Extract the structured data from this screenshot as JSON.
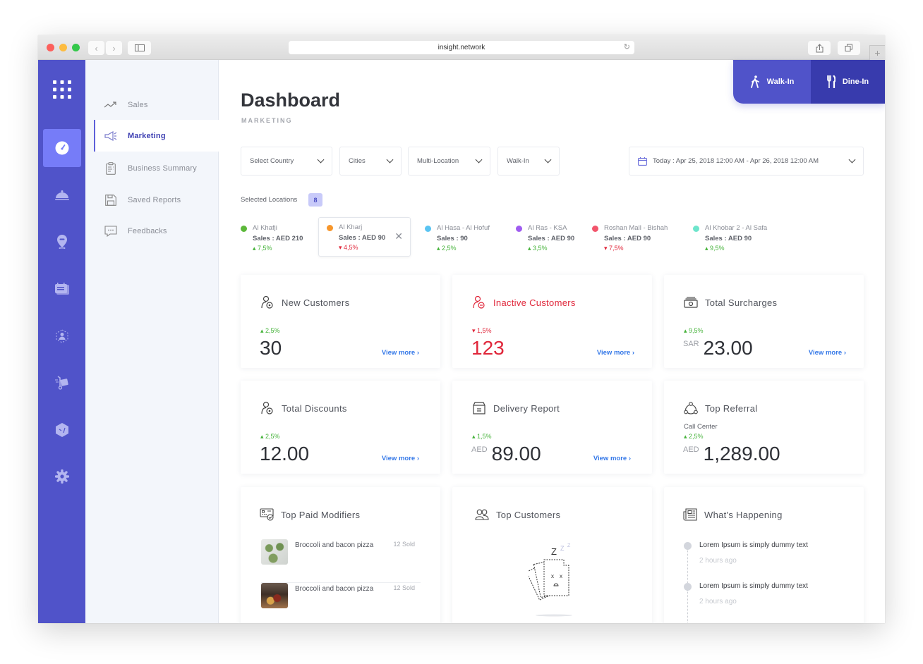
{
  "browser": {
    "url": "insight.network",
    "back_icon": "chevron-left-icon",
    "forward_icon": "chevron-right-icon",
    "sidebar_toggle_icon": "sidebar-icon",
    "reload_icon": "reload-icon",
    "share_icon": "share-icon",
    "tabs_icon": "tabs-icon",
    "new_tab_label": "+"
  },
  "rail": {
    "items": [
      {
        "icon": "apps-grid-icon"
      },
      {
        "icon": "dashboard-gauge-icon",
        "active": true
      },
      {
        "icon": "cloche-icon"
      },
      {
        "icon": "location-pin-icon"
      },
      {
        "icon": "menu-card-icon"
      },
      {
        "icon": "user-network-icon"
      },
      {
        "icon": "delivery-cart-icon"
      },
      {
        "icon": "box-icon"
      },
      {
        "icon": "settings-gear-icon"
      }
    ]
  },
  "subnav": {
    "items": [
      {
        "label": "Sales",
        "icon": "trending-up-icon"
      },
      {
        "label": "Marketing",
        "icon": "megaphone-icon",
        "active": true
      },
      {
        "label": "Business Summary",
        "icon": "clipboard-icon"
      },
      {
        "label": "Saved Reports",
        "icon": "floppy-disk-icon"
      },
      {
        "label": "Feedbacks",
        "icon": "chat-bubble-icon"
      }
    ]
  },
  "header": {
    "title": "Dashboard",
    "subtitle": "MARKETING"
  },
  "service_tabs": [
    {
      "label": "Walk-In",
      "icon": "walking-person-icon",
      "active": true
    },
    {
      "label": "Dine-In",
      "icon": "fork-knife-icon"
    }
  ],
  "filters": {
    "country": "Select Country",
    "cities": "Cities",
    "location": "Multi-Location",
    "service": "Walk-In",
    "date_range": "Today : Apr 25, 2018 12:00 AM - Apr 26, 2018 12:00 AM"
  },
  "selected_locations": {
    "label": "Selected Locations",
    "count": "8",
    "items": [
      {
        "name": "Al Khafji",
        "sales": "Sales : AED 210",
        "change": "7,5%",
        "trend": "up",
        "color": "#5cb83a"
      },
      {
        "name": "Al Kharj",
        "sales": "Sales : AED 90",
        "change": "4,5%",
        "trend": "down",
        "color": "#f7962b",
        "selected": true
      },
      {
        "name": "Al Hasa - Al Hofuf",
        "sales": "Sales : 90",
        "change": "2,5%",
        "trend": "up",
        "color": "#5ac4f2"
      },
      {
        "name": "Al Ras - KSA",
        "sales": "Sales : AED 90",
        "change": "3,5%",
        "trend": "up",
        "color": "#9f5cf0"
      },
      {
        "name": "Roshan Mall - Bishah",
        "sales": "Sales : AED 90",
        "change": "7,5%",
        "trend": "down",
        "color": "#f2556c"
      },
      {
        "name": "Al Khobar 2 - Al Safa",
        "sales": "Sales : AED 90",
        "change": "9,5%",
        "trend": "up",
        "color": "#6ee5cc"
      }
    ]
  },
  "cards": {
    "new_customers": {
      "title": "New Customers",
      "change": "2,5%",
      "trend": "up",
      "value": "30",
      "currency": "",
      "link": "View more"
    },
    "inactive_customers": {
      "title": "Inactive Customers",
      "change": "1,5%",
      "trend": "down",
      "value": "123",
      "currency": "",
      "link": "View more"
    },
    "total_surcharges": {
      "title": "Total Surcharges",
      "change": "9,5%",
      "trend": "up",
      "value": "23.00",
      "currency": "SAR",
      "link": "View more"
    },
    "total_discounts": {
      "title": "Total Discounts",
      "change": "2,5%",
      "trend": "up",
      "value": "12.00",
      "currency": "",
      "link": "View more"
    },
    "delivery_report": {
      "title": "Delivery Report",
      "change": "1,5%",
      "trend": "up",
      "value": "89.00",
      "currency": "AED",
      "link": "View more"
    },
    "top_referral": {
      "title": "Top Referral",
      "source": "Call Center",
      "change": "2,5%",
      "trend": "up",
      "value": "1,289.00",
      "currency": "AED"
    }
  },
  "top_paid_modifiers": {
    "title": "Top Paid Modifiers",
    "items": [
      {
        "name": "Broccoli and bacon pizza",
        "sold": "12 Sold"
      },
      {
        "name": "Broccoli and bacon pizza",
        "sold": "12 Sold"
      }
    ]
  },
  "top_customers": {
    "title": "Top Customers",
    "empty_state": "sleeping-cards-illustration"
  },
  "whats_happening": {
    "title": "What's Happening",
    "items": [
      {
        "text": "Lorem Ipsum is simply dummy text",
        "time": "2 hours ago"
      },
      {
        "text": "Lorem Ipsum is simply dummy text",
        "time": "2 hours ago"
      }
    ]
  },
  "colors": {
    "brand": "#5053c9",
    "brand_dark": "#383bad",
    "active_rail": "#767cf8",
    "positive": "#46b33b",
    "negative": "#e0263a",
    "link": "#3478e8"
  }
}
